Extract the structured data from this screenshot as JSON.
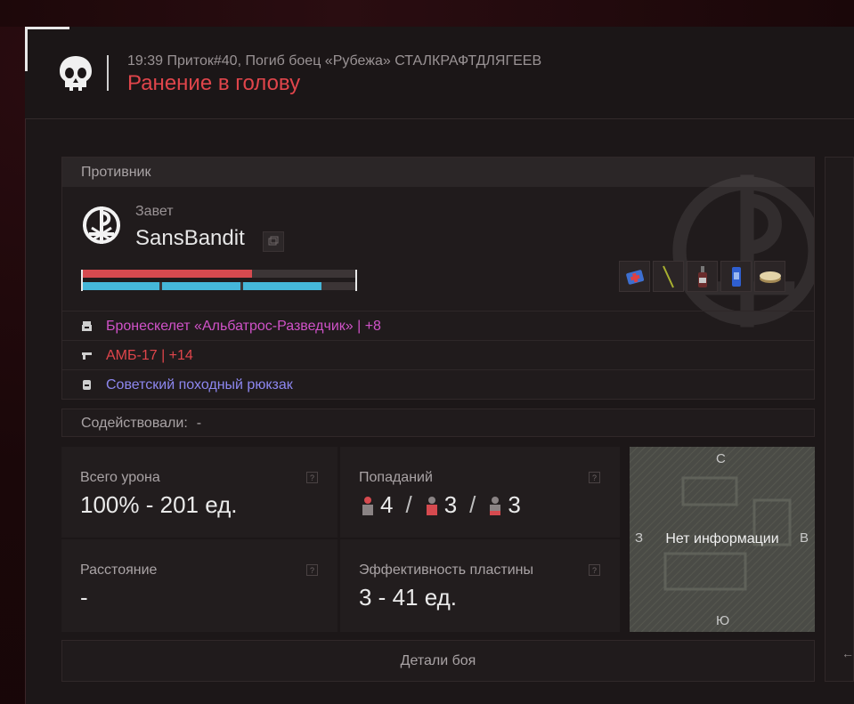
{
  "header": {
    "meta": "19:39 Приток#40, Погиб боец «Рубежа» СТАЛКРАФТДЛЯГЕЕВ",
    "title": "Ранение в голову"
  },
  "enemy": {
    "section_label": "Противник",
    "faction": "Завет",
    "player_name": "SansBandit",
    "health_fraction": 0.62,
    "shield_segments_filled": 3,
    "shield_fraction": 0.87,
    "quick_items": [
      "medkit-icon",
      "needle-icon",
      "bottle-icon",
      "can-icon",
      "bandage-icon"
    ],
    "equipment": [
      {
        "icon": "armor-icon",
        "text": "Бронескелет «Альбатрос-Разведчик»  |  +8",
        "color": "#d052c8"
      },
      {
        "icon": "gun-icon",
        "text": "АМБ-17  |  +14",
        "color": "#e0454b"
      },
      {
        "icon": "backpack-icon",
        "text": "Советский походный рюкзак",
        "color": "#8d87f0"
      }
    ]
  },
  "assist": {
    "label": "Содействовали:",
    "value": "-"
  },
  "stats": {
    "damage_label": "Всего урона",
    "damage_value": "100% - 201 ед.",
    "hits_label": "Попаданий",
    "hits": [
      "4",
      "3",
      "3"
    ],
    "hits_separator": "/",
    "distance_label": "Расстояние",
    "distance_value": "-",
    "plate_label": "Эффективность пластины",
    "plate_value": "3 - 41 ед.",
    "help_glyph": "?"
  },
  "map": {
    "north": "С",
    "south": "Ю",
    "west": "З",
    "east": "В",
    "message": "Нет информации"
  },
  "details_button": "Детали боя",
  "colors": {
    "accent_red": "#e0454b",
    "shield_blue": "#45b7d9"
  }
}
